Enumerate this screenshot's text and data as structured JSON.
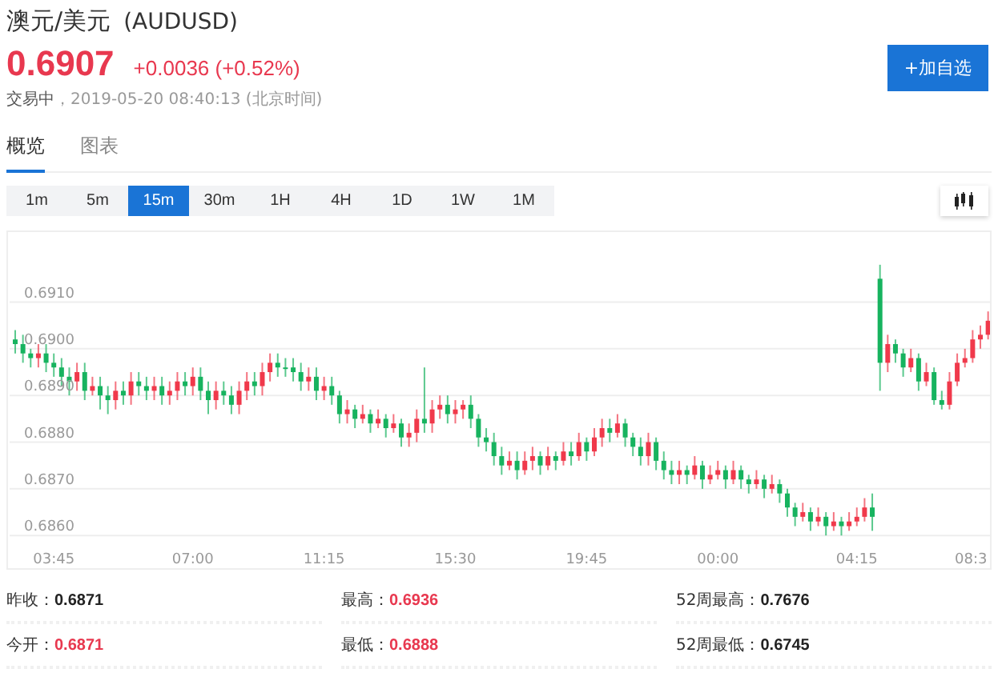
{
  "title": "澳元/美元",
  "symbol": "(AUDUSD)",
  "price": "0.6907",
  "change": "+0.0036 (+0.52%)",
  "status": "交易中",
  "timestamp": "，2019-05-20 08:40:13",
  "timezone": "(北京时间)",
  "watch_button": "+加自选",
  "tabs": [
    {
      "label": "概览",
      "selected": true
    },
    {
      "label": "图表",
      "selected": false
    }
  ],
  "intervals": [
    {
      "label": "1m",
      "selected": false
    },
    {
      "label": "5m",
      "selected": false
    },
    {
      "label": "15m",
      "selected": true
    },
    {
      "label": "30m",
      "selected": false
    },
    {
      "label": "1H",
      "selected": false
    },
    {
      "label": "4H",
      "selected": false
    },
    {
      "label": "1D",
      "selected": false
    },
    {
      "label": "1W",
      "selected": false
    },
    {
      "label": "1M",
      "selected": false
    }
  ],
  "chart": {
    "x_labels": [
      "03:45",
      "07:00",
      "11:15",
      "15:30",
      "19:45",
      "00:00",
      "04:15",
      "08:3"
    ],
    "chart_data": {
      "type": "candlestick",
      "grid": true,
      "ylim": [
        0.6853,
        0.6925
      ],
      "yticks": [
        {
          "value": 0.691,
          "label": "0.6910"
        },
        {
          "value": 0.69,
          "label": "0.6900"
        },
        {
          "value": 0.689,
          "label": "0.6890"
        },
        {
          "value": 0.688,
          "label": "0.6880"
        },
        {
          "value": 0.687,
          "label": "0.6870"
        },
        {
          "value": 0.686,
          "label": "0.6860"
        }
      ],
      "ohlc": [
        [
          0.6902,
          0.6904,
          0.6899,
          0.6901
        ],
        [
          0.6901,
          0.6903,
          0.6897,
          0.6899
        ],
        [
          0.6899,
          0.69,
          0.6896,
          0.6898
        ],
        [
          0.6898,
          0.6901,
          0.6896,
          0.6899
        ],
        [
          0.6899,
          0.6901,
          0.6895,
          0.6897
        ],
        [
          0.6897,
          0.6899,
          0.6894,
          0.6896
        ],
        [
          0.6896,
          0.6898,
          0.6892,
          0.6894
        ],
        [
          0.6894,
          0.6896,
          0.689,
          0.6893
        ],
        [
          0.6893,
          0.6897,
          0.6891,
          0.6895
        ],
        [
          0.6895,
          0.6897,
          0.6889,
          0.6891
        ],
        [
          0.6891,
          0.6894,
          0.689,
          0.6892
        ],
        [
          0.6892,
          0.6894,
          0.6887,
          0.689
        ],
        [
          0.689,
          0.6892,
          0.6886,
          0.6889
        ],
        [
          0.6889,
          0.6893,
          0.6887,
          0.6891
        ],
        [
          0.6891,
          0.6893,
          0.6888,
          0.689
        ],
        [
          0.689,
          0.6895,
          0.6888,
          0.6893
        ],
        [
          0.6893,
          0.6895,
          0.689,
          0.6892
        ],
        [
          0.6892,
          0.6894,
          0.6889,
          0.6891
        ],
        [
          0.6891,
          0.6894,
          0.6889,
          0.6892
        ],
        [
          0.6892,
          0.6894,
          0.6888,
          0.689
        ],
        [
          0.689,
          0.6893,
          0.6888,
          0.6891
        ],
        [
          0.6891,
          0.6895,
          0.6889,
          0.6893
        ],
        [
          0.6893,
          0.6895,
          0.689,
          0.6892
        ],
        [
          0.6892,
          0.6896,
          0.689,
          0.6894
        ],
        [
          0.6894,
          0.6896,
          0.6889,
          0.6891
        ],
        [
          0.6891,
          0.6893,
          0.6886,
          0.6889
        ],
        [
          0.6889,
          0.6893,
          0.6887,
          0.6891
        ],
        [
          0.6891,
          0.6893,
          0.6888,
          0.689
        ],
        [
          0.689,
          0.6892,
          0.6886,
          0.6888
        ],
        [
          0.6888,
          0.6893,
          0.6886,
          0.6891
        ],
        [
          0.6891,
          0.6895,
          0.6889,
          0.6893
        ],
        [
          0.6893,
          0.6895,
          0.689,
          0.6892
        ],
        [
          0.6892,
          0.6897,
          0.689,
          0.6895
        ],
        [
          0.6895,
          0.6899,
          0.6893,
          0.6897
        ],
        [
          0.6897,
          0.6899,
          0.6894,
          0.6896
        ],
        [
          0.6896,
          0.6898,
          0.6894,
          0.6896
        ],
        [
          0.6896,
          0.6898,
          0.6893,
          0.6895
        ],
        [
          0.6895,
          0.6897,
          0.6891,
          0.6893
        ],
        [
          0.6893,
          0.6896,
          0.6891,
          0.6894
        ],
        [
          0.6894,
          0.6896,
          0.6889,
          0.6891
        ],
        [
          0.6891,
          0.6894,
          0.6889,
          0.6892
        ],
        [
          0.6892,
          0.6894,
          0.6888,
          0.689
        ],
        [
          0.689,
          0.6891,
          0.6884,
          0.6886
        ],
        [
          0.6886,
          0.6889,
          0.6884,
          0.6887
        ],
        [
          0.6887,
          0.6888,
          0.6883,
          0.6885
        ],
        [
          0.6885,
          0.6888,
          0.6884,
          0.6886
        ],
        [
          0.6886,
          0.6887,
          0.6882,
          0.6884
        ],
        [
          0.6884,
          0.6887,
          0.6883,
          0.6885
        ],
        [
          0.6885,
          0.6886,
          0.6881,
          0.6883
        ],
        [
          0.6883,
          0.6886,
          0.6882,
          0.6884
        ],
        [
          0.6884,
          0.6885,
          0.6879,
          0.6881
        ],
        [
          0.6881,
          0.6884,
          0.6879,
          0.6882
        ],
        [
          0.6882,
          0.6887,
          0.688,
          0.6885
        ],
        [
          0.6885,
          0.6896,
          0.6882,
          0.6884
        ],
        [
          0.6884,
          0.6889,
          0.6882,
          0.6887
        ],
        [
          0.6887,
          0.689,
          0.6885,
          0.6888
        ],
        [
          0.6888,
          0.689,
          0.6884,
          0.6886
        ],
        [
          0.6886,
          0.6889,
          0.6884,
          0.6887
        ],
        [
          0.6887,
          0.6889,
          0.6885,
          0.6888
        ],
        [
          0.6888,
          0.689,
          0.6883,
          0.6885
        ],
        [
          0.6885,
          0.6886,
          0.6879,
          0.6881
        ],
        [
          0.6881,
          0.6883,
          0.6878,
          0.688
        ],
        [
          0.688,
          0.6882,
          0.6875,
          0.6877
        ],
        [
          0.6877,
          0.6879,
          0.6873,
          0.6875
        ],
        [
          0.6875,
          0.6878,
          0.6874,
          0.6876
        ],
        [
          0.6876,
          0.6878,
          0.6872,
          0.6874
        ],
        [
          0.6874,
          0.6878,
          0.6873,
          0.6876
        ],
        [
          0.6876,
          0.6879,
          0.6874,
          0.6877
        ],
        [
          0.6877,
          0.6878,
          0.6873,
          0.6875
        ],
        [
          0.6875,
          0.6879,
          0.6874,
          0.6877
        ],
        [
          0.6877,
          0.6878,
          0.6874,
          0.6876
        ],
        [
          0.6876,
          0.688,
          0.6875,
          0.6878
        ],
        [
          0.6878,
          0.688,
          0.6875,
          0.6877
        ],
        [
          0.6877,
          0.6882,
          0.6876,
          0.688
        ],
        [
          0.688,
          0.6881,
          0.6876,
          0.6878
        ],
        [
          0.6878,
          0.6883,
          0.6877,
          0.6881
        ],
        [
          0.6881,
          0.6885,
          0.6879,
          0.6883
        ],
        [
          0.6883,
          0.6885,
          0.688,
          0.6882
        ],
        [
          0.6882,
          0.6886,
          0.6881,
          0.6884
        ],
        [
          0.6884,
          0.6885,
          0.6879,
          0.6881
        ],
        [
          0.6881,
          0.6882,
          0.6877,
          0.6879
        ],
        [
          0.6879,
          0.6881,
          0.6875,
          0.6877
        ],
        [
          0.6877,
          0.6882,
          0.6875,
          0.688
        ],
        [
          0.688,
          0.6881,
          0.6874,
          0.6876
        ],
        [
          0.6876,
          0.6878,
          0.6872,
          0.6874
        ],
        [
          0.6874,
          0.6876,
          0.6871,
          0.6873
        ],
        [
          0.6873,
          0.6876,
          0.6871,
          0.6874
        ],
        [
          0.6874,
          0.6875,
          0.6871,
          0.6873
        ],
        [
          0.6873,
          0.6877,
          0.6872,
          0.6875
        ],
        [
          0.6875,
          0.6876,
          0.687,
          0.6872
        ],
        [
          0.6872,
          0.6875,
          0.6871,
          0.6873
        ],
        [
          0.6873,
          0.6876,
          0.6872,
          0.6874
        ],
        [
          0.6874,
          0.6875,
          0.687,
          0.6872
        ],
        [
          0.6872,
          0.6876,
          0.6871,
          0.6874
        ],
        [
          0.6874,
          0.6875,
          0.687,
          0.6872
        ],
        [
          0.6872,
          0.6873,
          0.6869,
          0.6871
        ],
        [
          0.6871,
          0.6874,
          0.687,
          0.6872
        ],
        [
          0.6872,
          0.6873,
          0.6868,
          0.687
        ],
        [
          0.687,
          0.6873,
          0.6869,
          0.6871
        ],
        [
          0.6871,
          0.6872,
          0.6867,
          0.6869
        ],
        [
          0.6869,
          0.687,
          0.6864,
          0.6866
        ],
        [
          0.6866,
          0.6867,
          0.6862,
          0.6864
        ],
        [
          0.6864,
          0.6867,
          0.6863,
          0.6865
        ],
        [
          0.6865,
          0.6866,
          0.6861,
          0.6863
        ],
        [
          0.6863,
          0.6866,
          0.6862,
          0.6864
        ],
        [
          0.6864,
          0.6865,
          0.686,
          0.6862
        ],
        [
          0.6862,
          0.6865,
          0.6861,
          0.6863
        ],
        [
          0.6863,
          0.6864,
          0.686,
          0.6862
        ],
        [
          0.6862,
          0.6865,
          0.6861,
          0.6863
        ],
        [
          0.6863,
          0.6866,
          0.6862,
          0.6864
        ],
        [
          0.6864,
          0.6868,
          0.6863,
          0.6866
        ],
        [
          0.6866,
          0.6869,
          0.6861,
          0.6864
        ],
        [
          0.6915,
          0.6918,
          0.6891,
          0.6897
        ],
        [
          0.6897,
          0.6903,
          0.6895,
          0.6901
        ],
        [
          0.6901,
          0.6902,
          0.6897,
          0.6899
        ],
        [
          0.6899,
          0.69,
          0.6894,
          0.6896
        ],
        [
          0.6896,
          0.69,
          0.6895,
          0.6898
        ],
        [
          0.6898,
          0.6899,
          0.6891,
          0.6893
        ],
        [
          0.6893,
          0.6897,
          0.6892,
          0.6895
        ],
        [
          0.6895,
          0.6896,
          0.6888,
          0.6889
        ],
        [
          0.6889,
          0.6891,
          0.6887,
          0.6888
        ],
        [
          0.6888,
          0.6895,
          0.6887,
          0.6893
        ],
        [
          0.6893,
          0.6899,
          0.6892,
          0.6897
        ],
        [
          0.6897,
          0.69,
          0.6896,
          0.6898
        ],
        [
          0.6898,
          0.6904,
          0.6897,
          0.6902
        ],
        [
          0.6902,
          0.6905,
          0.69,
          0.6903
        ],
        [
          0.6903,
          0.6908,
          0.6902,
          0.6906
        ]
      ]
    }
  },
  "stats": [
    {
      "label": "昨收：",
      "value": "0.6871",
      "color": "#222222"
    },
    {
      "label": "最高：",
      "value": "0.6936",
      "color": "#e8384f"
    },
    {
      "label": "52周最高：",
      "value": "0.7676",
      "color": "#222222"
    },
    {
      "label": "今开：",
      "value": "0.6871",
      "color": "#e8384f"
    },
    {
      "label": "最低：",
      "value": "0.6888",
      "color": "#e8384f"
    },
    {
      "label": "52周最低：",
      "value": "0.6745",
      "color": "#222222"
    }
  ]
}
